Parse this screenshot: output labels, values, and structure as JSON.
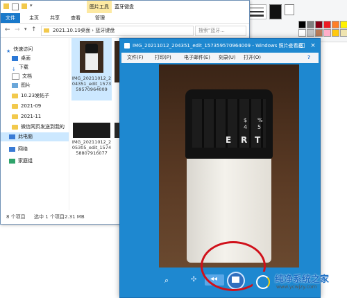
{
  "explorer": {
    "title": "蓝牙键盘",
    "picture_tools": "图片工具",
    "tabs": [
      "文件",
      "主页",
      "共享",
      "查看",
      "管理"
    ],
    "address": "2021.10.19桌面 › 蓝牙键盘",
    "search_placeholder": "搜索\"蓝牙...",
    "nav": [
      {
        "label": "快速访问"
      },
      {
        "label": "桌面"
      },
      {
        "label": "下载"
      },
      {
        "label": "文档"
      },
      {
        "label": "图片"
      },
      {
        "label": "10.23发帖子"
      },
      {
        "label": "2021-09"
      },
      {
        "label": "2021-11"
      },
      {
        "label": "微信网页发送到我的"
      },
      {
        "label": "此电脑"
      },
      {
        "label": "网络"
      },
      {
        "label": "家庭组"
      }
    ],
    "files": [
      {
        "name": "IMG_20211012_204351_edit_157359570964009"
      },
      {
        "name": "IMG_20211012_205305_edit_157458807916077"
      }
    ],
    "status": {
      "count": "8 个项目",
      "selected": "选中 1 个项目",
      "size": "2.31 MB"
    }
  },
  "viewer": {
    "title": "IMG_20211012_204351_edit_157359570964009 - Windows 照片查看器",
    "menu": [
      "文件(F)",
      "打印(P)",
      "电子邮件(E)",
      "刻录(U)",
      "打开(O)"
    ],
    "keys": [
      "E",
      "R",
      "T",
      "$",
      "4",
      "%",
      "5"
    ]
  },
  "watermark": {
    "brand": "纯净系统之家",
    "url": "www.ycwjzy.com"
  },
  "colors": {
    "accent": "#1e88d0",
    "highlight": "#cce8ff",
    "annotation": "#d0101a"
  }
}
